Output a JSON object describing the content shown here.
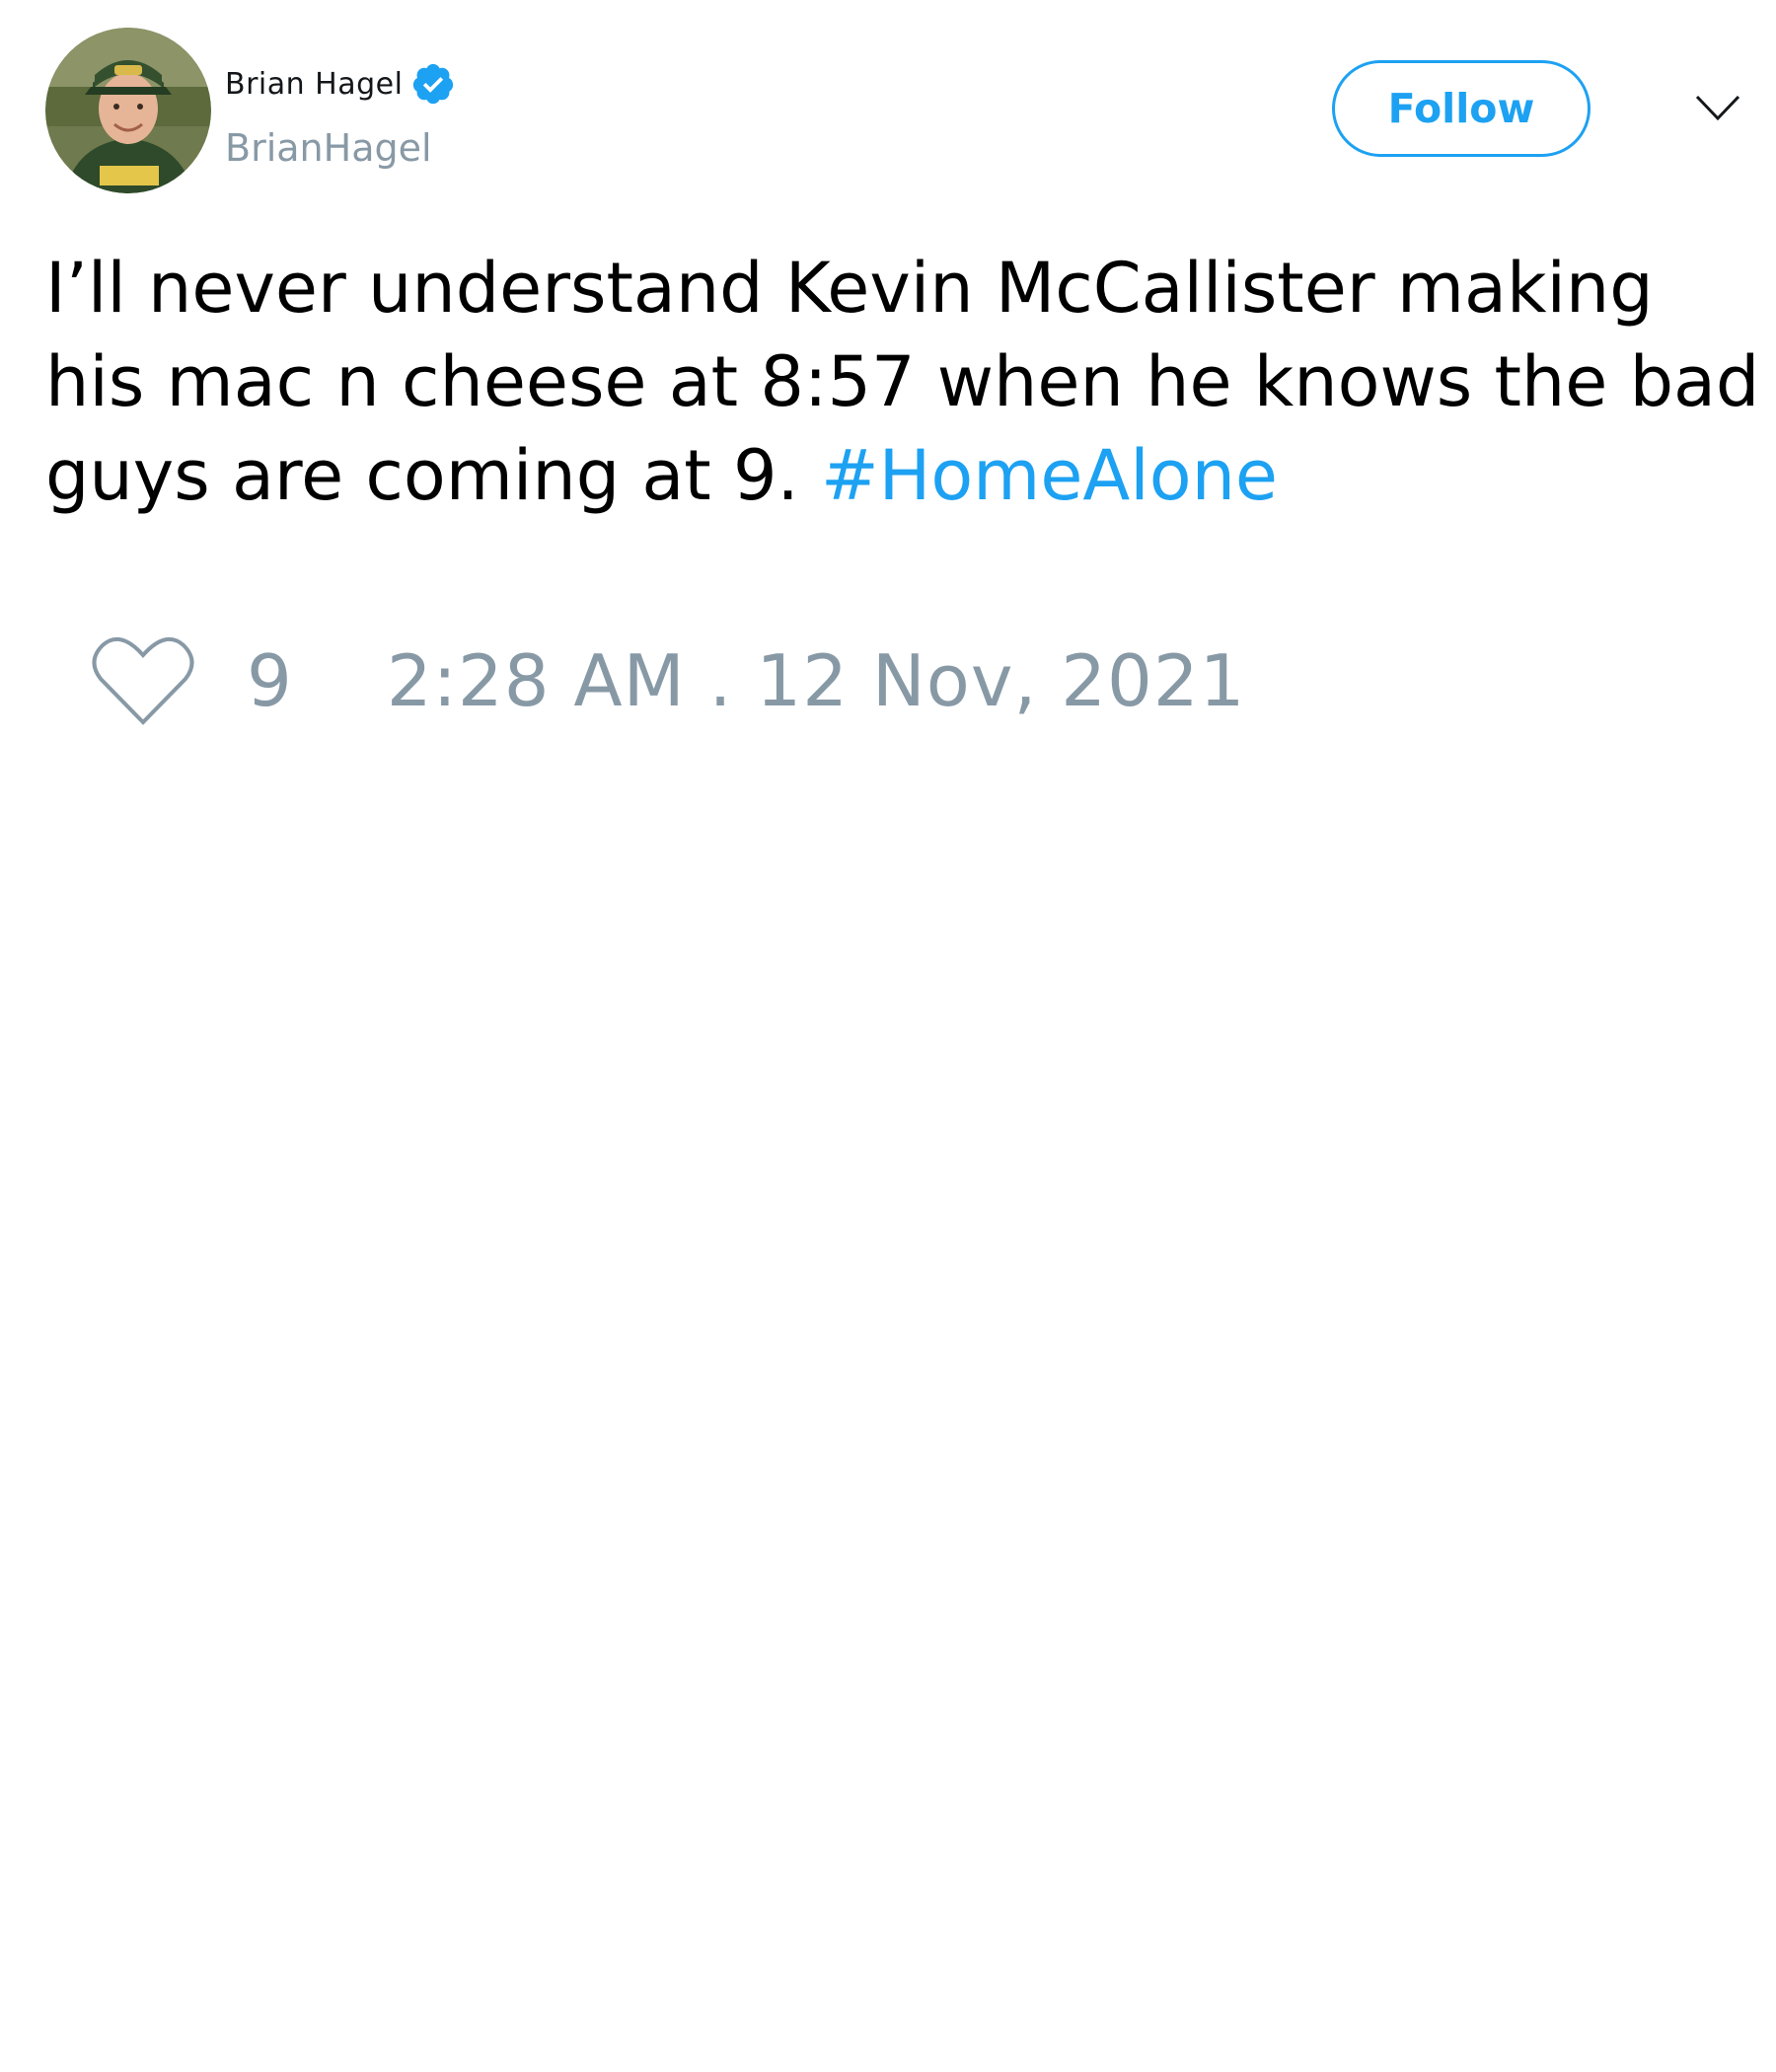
{
  "user": {
    "display_name": "Brian Hagel",
    "handle": "BrianHagel",
    "verified": true
  },
  "header": {
    "follow_label": "Follow"
  },
  "tweet": {
    "text": "I’ll never understand Kevin McCallister making his mac n cheese at 8:57 when he knows the bad guys are coming at 9. ",
    "hashtag": "#HomeAlone"
  },
  "footer": {
    "like_count": "9",
    "timestamp": "2:28 AM . 12 Nov, 2021"
  },
  "icons": {
    "verified": "verified-badge-icon",
    "caret": "chevron-down-icon",
    "like": "heart-icon"
  },
  "colors": {
    "accent": "#1da1f2",
    "muted": "#8899a6",
    "text": "#000000"
  }
}
